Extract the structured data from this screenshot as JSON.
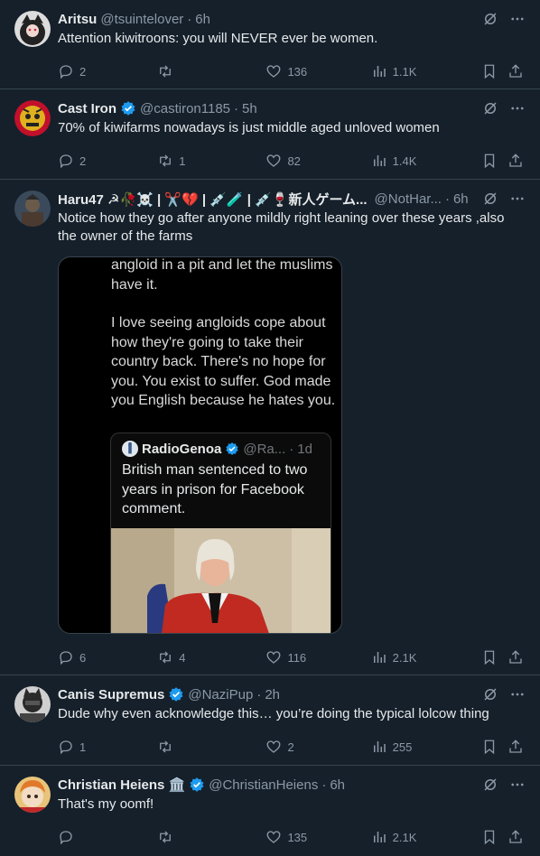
{
  "tweets": [
    {
      "name": "Aritsu",
      "handle": "@tsuintelover",
      "time": "6h",
      "text": "Attention kiwitroons: you will NEVER ever be women.",
      "replies": "2",
      "retweets": "",
      "likes": "136",
      "views": "1.1K"
    },
    {
      "name": "Cast Iron",
      "handle": "@castiron1185",
      "time": "5h",
      "text": "70% of kiwifarms nowadays is just middle aged unloved women",
      "replies": "2",
      "retweets": "1",
      "likes": "82",
      "views": "1.4K"
    },
    {
      "name": "Haru47 ☭🥀☠️ | ✂️💔 | 💉🧪 | 💉🍷新人ゲーム...",
      "handle": "@NotHar...",
      "time": "6h",
      "text": "Notice how they go after anyone mildly right leaning over these years ,also the owner of the farms",
      "replies": "6",
      "retweets": "4",
      "likes": "116",
      "views": "2.1K",
      "media": {
        "line1": "angloid in a pit and let the muslims have it.",
        "line2": "I love seeing angloids cope about how they're going to take their country back. There's no hope for you. You exist to suffer. God made you English because he hates you.",
        "quote_name": "RadioGenoa",
        "quote_handle": "@Ra...",
        "quote_time": "1d",
        "quote_text": "British man sentenced to two years in prison for Facebook comment."
      }
    },
    {
      "name": "Canis Supremus",
      "handle": "@NaziPup",
      "time": "2h",
      "text": "Dude why even acknowledge this… you’re doing the typical lolcow thing",
      "replies": "1",
      "retweets": "",
      "likes": "2",
      "views": "255"
    },
    {
      "name": "Christian Heiens 🏛️",
      "handle": "@ChristianHeiens",
      "time": "6h",
      "text": "That's my oomf!",
      "replies": "",
      "retweets": "",
      "likes": "135",
      "views": "2.1K"
    }
  ],
  "colors": {
    "background": "#15202b",
    "border": "#38444d",
    "text": "#e7e9ea",
    "muted": "#8b98a5",
    "verified": "#1d9bf0"
  },
  "icons": [
    "grok-icon",
    "more-icon",
    "reply-icon",
    "retweet-icon",
    "like-icon",
    "views-icon",
    "bookmark-icon",
    "share-icon",
    "verified-badge-icon"
  ]
}
